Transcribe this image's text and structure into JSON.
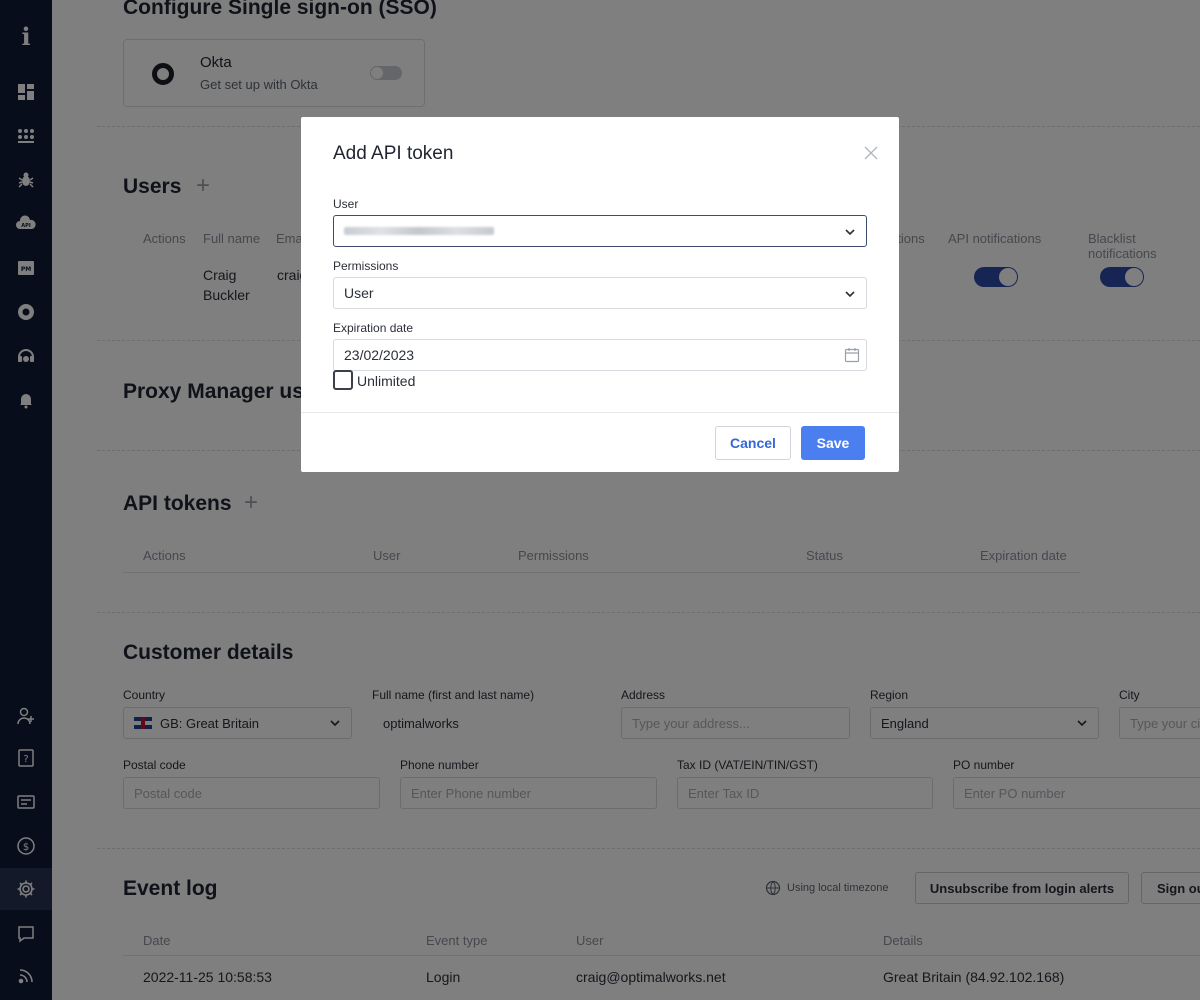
{
  "app": {
    "logo_glyph": "i",
    "accent_color": "#4b7ff0",
    "sidebar_bg": "#0f1a36"
  },
  "sidebar": {
    "items": [
      {
        "name": "dashboard-icon"
      },
      {
        "name": "proxies-icon"
      },
      {
        "name": "scraper-icon"
      },
      {
        "name": "api-icon",
        "text": "API"
      },
      {
        "name": "proxy-manager-icon",
        "text": "PM"
      },
      {
        "name": "browser-icon"
      },
      {
        "name": "support-icon"
      },
      {
        "name": "bell-icon"
      },
      {
        "name": "add-user-icon"
      },
      {
        "name": "help-icon"
      },
      {
        "name": "billing-icon"
      },
      {
        "name": "dollar-icon"
      },
      {
        "name": "settings-icon",
        "active": true
      },
      {
        "name": "chat-icon"
      },
      {
        "name": "feed-icon"
      }
    ]
  },
  "sso": {
    "title": "Configure Single sign-on (SSO)",
    "okta": {
      "name": "Okta",
      "subtitle": "Get set up with Okta",
      "enabled": false
    }
  },
  "users": {
    "title": "Users",
    "columns": [
      "Actions",
      "Full name",
      "Ema",
      "ations",
      "API notifications",
      "Blacklist notifications"
    ],
    "rows": [
      {
        "full_name_1": "Craig",
        "full_name_2": "Buckler",
        "email": "craig",
        "api_notifications": true,
        "blacklist_notifications": true
      }
    ]
  },
  "proxy_manager": {
    "title": "Proxy Manager use"
  },
  "api_tokens": {
    "title": "API tokens",
    "columns": [
      "Actions",
      "User",
      "Permissions",
      "Status",
      "Expiration date"
    ]
  },
  "customer": {
    "title": "Customer details",
    "country": {
      "label": "Country",
      "value": "GB: Great Britain"
    },
    "full_name": {
      "label": "Full name (first and last name)",
      "value": "optimalworks"
    },
    "address": {
      "label": "Address",
      "placeholder": "Type your address..."
    },
    "region": {
      "label": "Region",
      "value": "England"
    },
    "city": {
      "label": "City",
      "placeholder": "Type your ci"
    },
    "postal": {
      "label": "Postal code",
      "placeholder": "Postal code"
    },
    "phone": {
      "label": "Phone number",
      "placeholder": "Enter Phone number"
    },
    "tax": {
      "label": "Tax ID (VAT/EIN/TIN/GST)",
      "placeholder": "Enter Tax ID"
    },
    "po": {
      "label": "PO number",
      "placeholder": "Enter PO number"
    }
  },
  "event_log": {
    "title": "Event log",
    "timezone": "Using local timezone",
    "unsubscribe_label": "Unsubscribe from login alerts",
    "signout_label": "Sign ou",
    "columns": [
      "Date",
      "Event type",
      "User",
      "Details"
    ],
    "rows": [
      {
        "date": "2022-11-25 10:58:53",
        "type": "Login",
        "user": "craig@optimalworks.net",
        "details": "Great Britain (84.92.102.168)"
      }
    ]
  },
  "modal": {
    "title": "Add API token",
    "user_label": "User",
    "permissions_label": "Permissions",
    "permissions_value": "User",
    "expiration_label": "Expiration date",
    "expiration_value": "23/02/2023",
    "unlimited_label": "Unlimited",
    "unlimited_checked": false,
    "cancel_label": "Cancel",
    "save_label": "Save"
  }
}
